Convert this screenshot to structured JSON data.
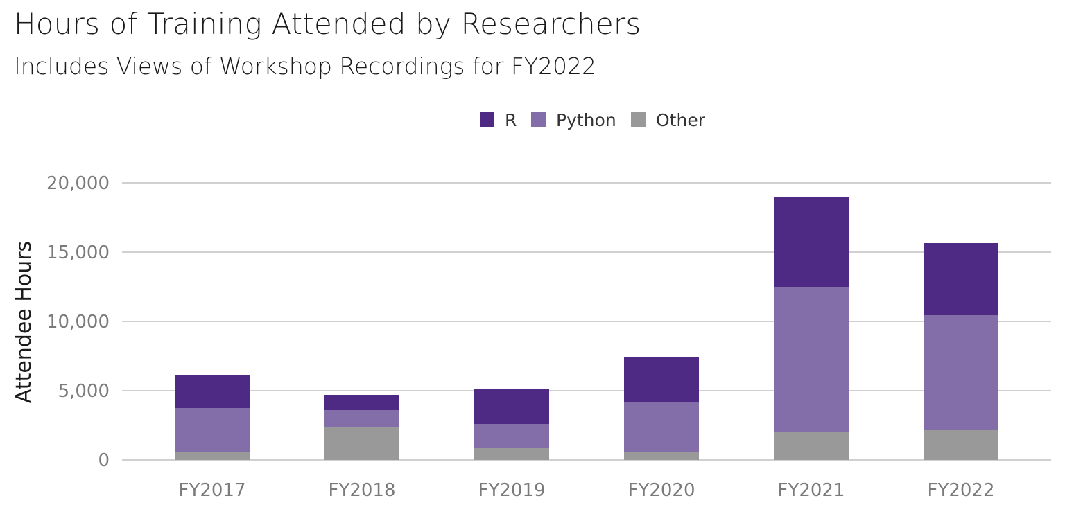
{
  "chart_data": {
    "type": "bar",
    "stacked": true,
    "title": "Hours of Training Attended by Researchers",
    "subtitle": "Includes Views of Workshop Recordings for FY2022",
    "xlabel": "",
    "ylabel": "Attendee Hours",
    "ylim": [
      0,
      20000
    ],
    "yticks": [
      0,
      5000,
      10000,
      15000,
      20000
    ],
    "ytick_labels": [
      "0",
      "5,000",
      "10,000",
      "15,000",
      "20,000"
    ],
    "grid": true,
    "legend_position": "top-center",
    "categories": [
      "FY2017",
      "FY2018",
      "FY2019",
      "FY2020",
      "FY2021",
      "FY2022"
    ],
    "series": [
      {
        "name": "Other",
        "color": "#999999",
        "values": [
          600,
          2350,
          850,
          550,
          2000,
          2150
        ]
      },
      {
        "name": "Python",
        "color": "#836eaa",
        "values": [
          3150,
          1250,
          1750,
          3650,
          10450,
          8300
        ]
      },
      {
        "name": "R",
        "color": "#4e2a84",
        "values": [
          2400,
          1100,
          2550,
          3250,
          6500,
          5200
        ]
      }
    ],
    "legend_order": [
      "R",
      "Python",
      "Other"
    ]
  }
}
